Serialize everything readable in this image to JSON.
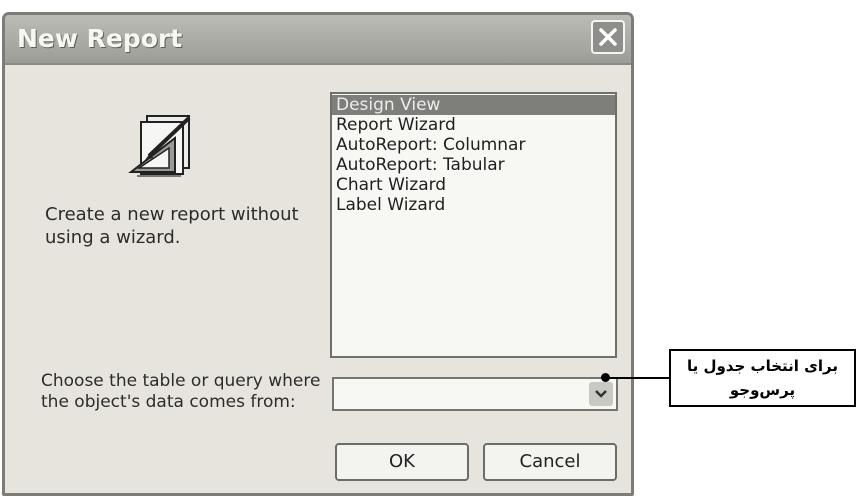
{
  "dialog": {
    "title": "New Report",
    "description": "Create a new report without using a wizard.",
    "options": [
      "Design View",
      "Report Wizard",
      "AutoReport:  Columnar",
      "AutoReport:  Tabular",
      "Chart Wizard",
      "Label Wizard"
    ],
    "selected_option": "Design View",
    "source_label": "Choose the table or query where the object's data comes from:",
    "source_value": "",
    "ok_label": "OK",
    "cancel_label": "Cancel"
  },
  "callout": {
    "text": "برای انتخاب جدول یا پرس‌وجو"
  }
}
